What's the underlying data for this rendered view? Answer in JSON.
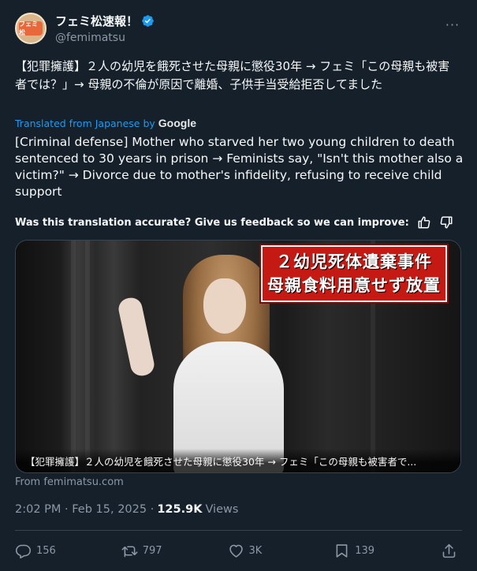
{
  "author": {
    "display_name": "フェミ松速報！",
    "handle": "@femimatsu",
    "avatar_text": "フェミ松"
  },
  "tweet": {
    "text": "【犯罪擁護】２人の幼児を餓死させた母親に懲役30年 → フェミ「この母親も被害者では？」→ 母親の不倫が原因で離婚、子供手当受給拒否してました",
    "translated_from": "Translated from Japanese by",
    "google_label": "Google",
    "translation": "[Criminal defense] Mother who starved her two young children to death sentenced to 30 years in prison → Feminists say, \"Isn't this mother also a victim?\" → Divorce due to mother's infidelity, refusing to receive child support",
    "feedback_prompt": "Was this translation accurate? Give us feedback so we can improve:"
  },
  "media": {
    "overlay_line1": "２幼児死体遺棄事件",
    "overlay_line2": "母親食料用意せず放置",
    "card_title": "【犯罪擁護】２人の幼児を餓死させた母親に懲役30年 → フェミ「この母親も被害者で...",
    "source": "From femimatsu.com"
  },
  "meta": {
    "timestamp": "2:02 PM · Feb 15, 2025 ·",
    "views_count": "125.9K",
    "views_label": "Views"
  },
  "actions": {
    "replies": "156",
    "reposts": "797",
    "likes": "3K",
    "bookmarks": "139"
  },
  "colors": {
    "background": "#15202b",
    "accent": "#1d9bf0",
    "muted": "#8b98a5",
    "border": "#38444d"
  }
}
